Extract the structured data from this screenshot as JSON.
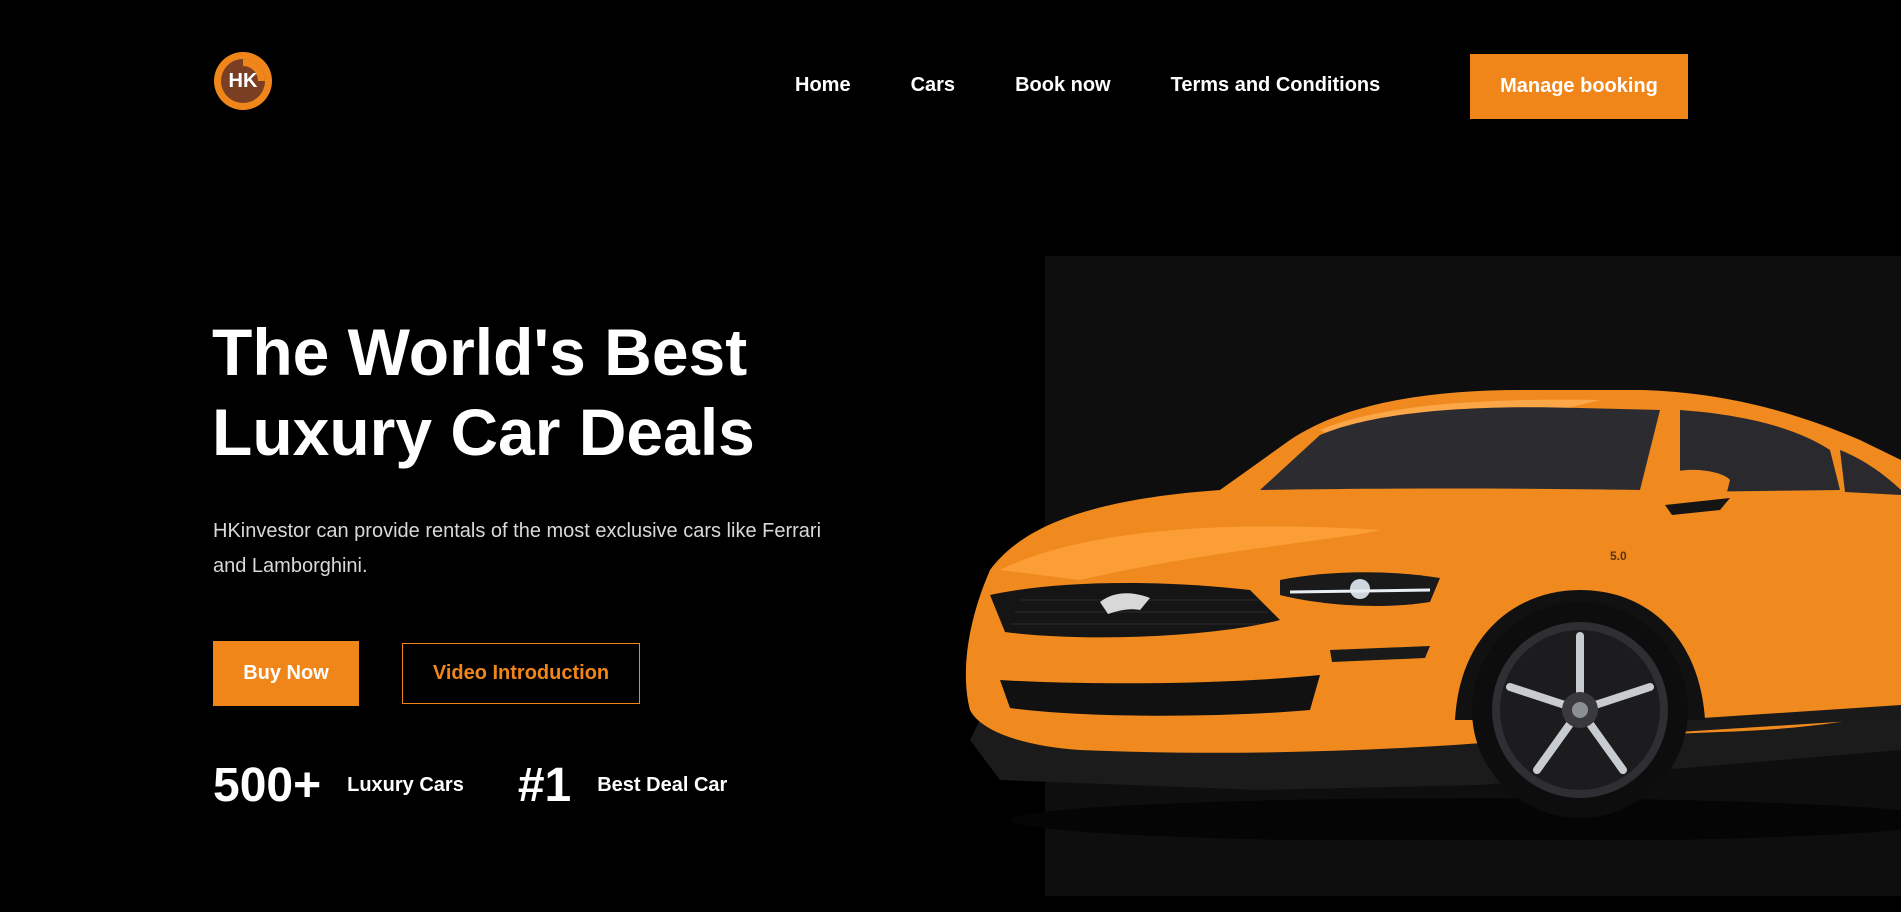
{
  "header": {
    "logo_text": "HK",
    "nav": [
      {
        "label": "Home"
      },
      {
        "label": "Cars"
      },
      {
        "label": "Book now"
      },
      {
        "label": "Terms and Conditions"
      }
    ],
    "manage_booking_label": "Manage booking"
  },
  "hero": {
    "title_line1": "The World's Best",
    "title_line2": "Luxury Car Deals",
    "description": "HKinvestor can provide rentals of the most exclusive cars like Ferrari and Lamborghini.",
    "buy_label": "Buy Now",
    "video_label": "Video Introduction",
    "stats": [
      {
        "value": "500+",
        "label": "Luxury Cars"
      },
      {
        "value": "#1",
        "label": "Best Deal Car"
      }
    ],
    "car_badge": "5.0"
  },
  "colors": {
    "accent": "#f0861a",
    "background": "#000000",
    "panel": "#0e0e0e",
    "logo_inner": "#7a3e22"
  },
  "icons": {
    "logo": "hk-logo-icon",
    "car": "orange-mustang-car-image"
  }
}
